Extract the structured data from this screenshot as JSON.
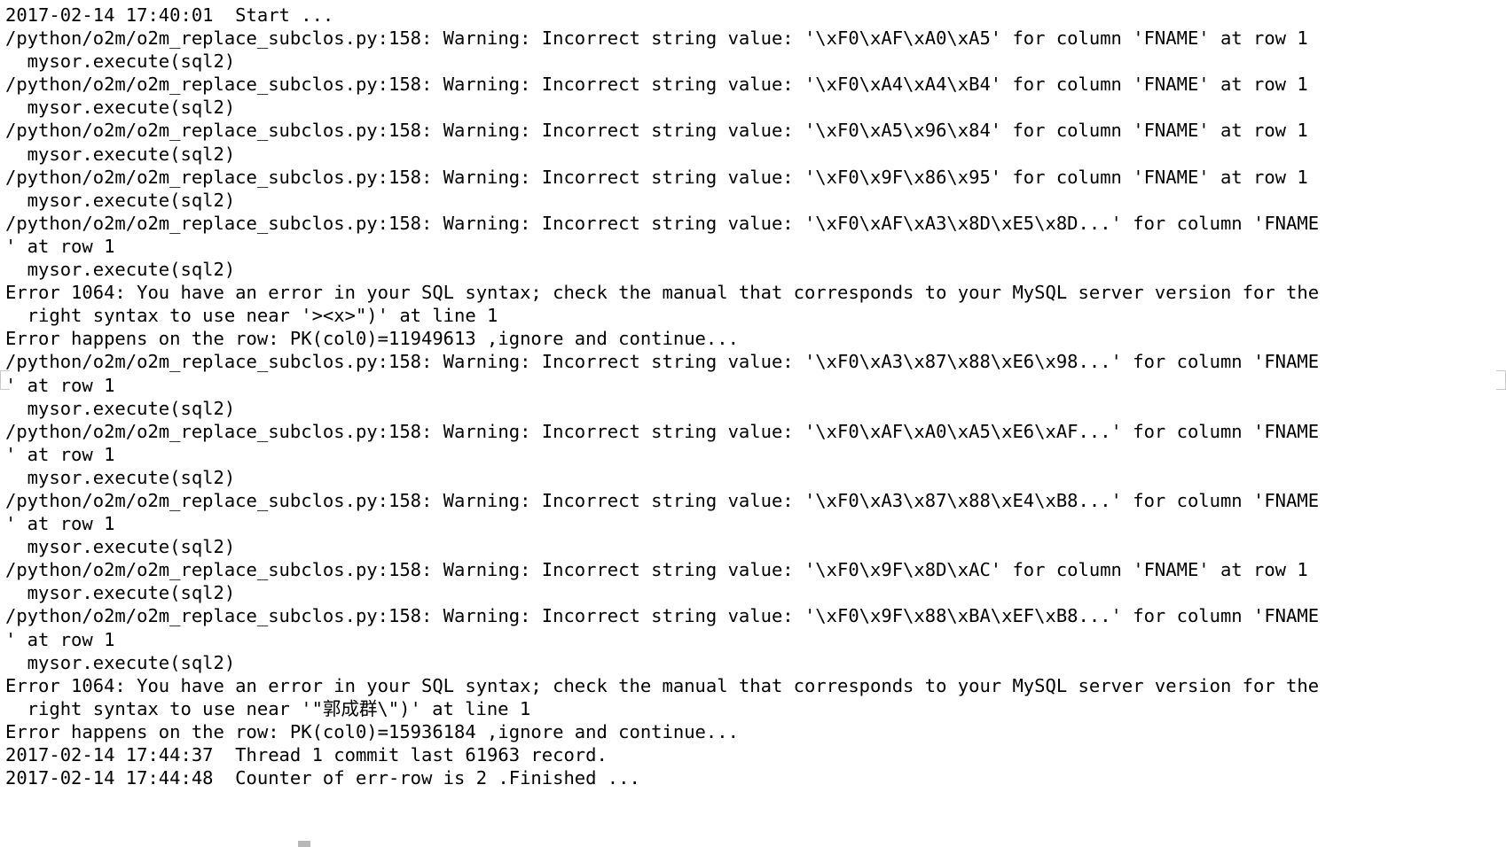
{
  "terminal": {
    "window_name": "terminal-log-output",
    "background_color": "#ffffff",
    "text_color": "#000000",
    "lines": [
      "2017-02-14 17:40:01  Start ...",
      "/python/o2m/o2m_replace_subclos.py:158: Warning: Incorrect string value: '\\xF0\\xAF\\xA0\\xA5' for column 'FNAME' at row 1",
      "  mysor.execute(sql2)",
      "/python/o2m/o2m_replace_subclos.py:158: Warning: Incorrect string value: '\\xF0\\xA4\\xA4\\xB4' for column 'FNAME' at row 1",
      "  mysor.execute(sql2)",
      "/python/o2m/o2m_replace_subclos.py:158: Warning: Incorrect string value: '\\xF0\\xA5\\x96\\x84' for column 'FNAME' at row 1",
      "  mysor.execute(sql2)",
      "/python/o2m/o2m_replace_subclos.py:158: Warning: Incorrect string value: '\\xF0\\x9F\\x86\\x95' for column 'FNAME' at row 1",
      "  mysor.execute(sql2)",
      "/python/o2m/o2m_replace_subclos.py:158: Warning: Incorrect string value: '\\xF0\\xAF\\xA3\\x8D\\xE5\\x8D...' for column 'FNAME",
      "' at row 1",
      "  mysor.execute(sql2)",
      "Error 1064: You have an error in your SQL syntax; check the manual that corresponds to your MySQL server version for the",
      "  right syntax to use near '><x>\")' at line 1",
      "Error happens on the row: PK(col0)=11949613 ,ignore and continue...",
      "/python/o2m/o2m_replace_subclos.py:158: Warning: Incorrect string value: '\\xF0\\xA3\\x87\\x88\\xE6\\x98...' for column 'FNAME",
      "' at row 1",
      "  mysor.execute(sql2)",
      "/python/o2m/o2m_replace_subclos.py:158: Warning: Incorrect string value: '\\xF0\\xAF\\xA0\\xA5\\xE6\\xAF...' for column 'FNAME",
      "' at row 1",
      "  mysor.execute(sql2)",
      "/python/o2m/o2m_replace_subclos.py:158: Warning: Incorrect string value: '\\xF0\\xA3\\x87\\x88\\xE4\\xB8...' for column 'FNAME",
      "' at row 1",
      "  mysor.execute(sql2)",
      "/python/o2m/o2m_replace_subclos.py:158: Warning: Incorrect string value: '\\xF0\\x9F\\x8D\\xAC' for column 'FNAME' at row 1",
      "  mysor.execute(sql2)",
      "/python/o2m/o2m_replace_subclos.py:158: Warning: Incorrect string value: '\\xF0\\x9F\\x88\\xBA\\xEF\\xB8...' for column 'FNAME",
      "' at row 1",
      "  mysor.execute(sql2)",
      "Error 1064: You have an error in your SQL syntax; check the manual that corresponds to your MySQL server version for the",
      "  right syntax to use near '\"郭成群\\\")' at line 1",
      "Error happens on the row: PK(col0)=15936184 ,ignore and continue...",
      "2017-02-14 17:44:37  Thread 1 commit last 61963 record.",
      "2017-02-14 17:44:48  Counter of err-row is 2 .Finished ..."
    ]
  }
}
